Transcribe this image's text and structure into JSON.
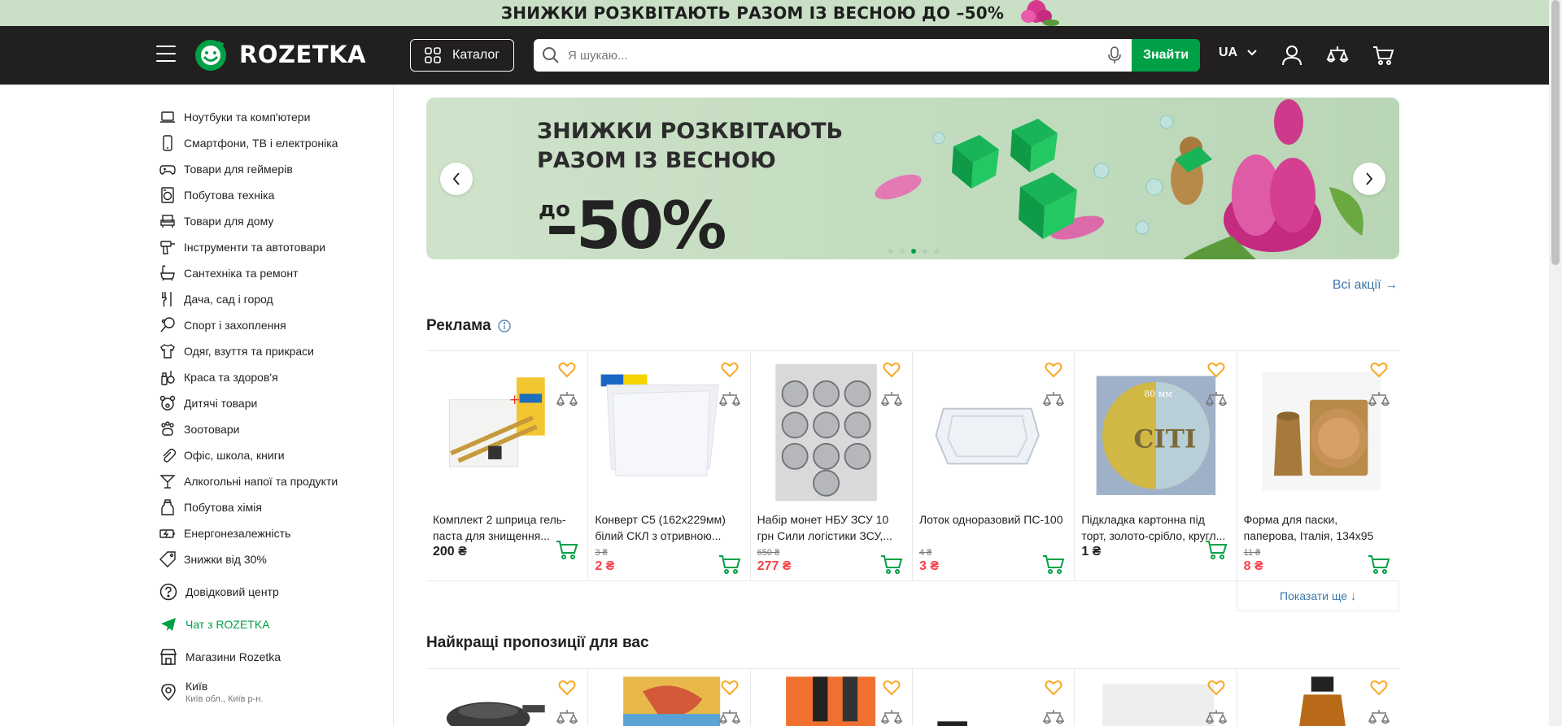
{
  "promo_strip": {
    "text": "ЗНИЖКИ РОЗКВІТАЮТЬ РАЗОМ ІЗ ВЕСНОЮ ДО –50%"
  },
  "header": {
    "logo_text": "ROZETKA",
    "catalog_label": "Каталог",
    "search_placeholder": "Я шукаю...",
    "search_button": "Знайти",
    "language": "UA"
  },
  "sidebar": {
    "categories": [
      {
        "label": "Ноутбуки та комп'ютери",
        "icon": "laptop-icon"
      },
      {
        "label": "Смартфони, ТВ і електроніка",
        "icon": "smartphone-icon"
      },
      {
        "label": "Товари для геймерів",
        "icon": "gamepad-icon"
      },
      {
        "label": "Побутова техніка",
        "icon": "washing-machine-icon"
      },
      {
        "label": "Товари для дому",
        "icon": "sofa-icon"
      },
      {
        "label": "Інструменти та автотовари",
        "icon": "drill-icon"
      },
      {
        "label": "Сантехніка та ремонт",
        "icon": "bathtub-icon"
      },
      {
        "label": "Дача, сад і город",
        "icon": "garden-fork-icon"
      },
      {
        "label": "Спорт і захоплення",
        "icon": "racket-icon"
      },
      {
        "label": "Одяг, взуття та прикраси",
        "icon": "tshirt-icon"
      },
      {
        "label": "Краса та здоров'я",
        "icon": "cosmetics-icon"
      },
      {
        "label": "Дитячі товари",
        "icon": "teddy-bear-icon"
      },
      {
        "label": "Зоотовари",
        "icon": "paw-icon"
      },
      {
        "label": "Офіс, школа, книги",
        "icon": "paperclip-icon"
      },
      {
        "label": "Алкогольні напої та продукти",
        "icon": "cocktail-icon"
      },
      {
        "label": "Побутова хімія",
        "icon": "detergent-icon"
      },
      {
        "label": "Енергонезалежність",
        "icon": "battery-icon"
      },
      {
        "label": "Знижки від 30%",
        "icon": "discount-tag-icon"
      }
    ],
    "help_center": "Довідковий центр",
    "chat": "Чат з ROZETKA",
    "stores": "Магазини Rozetka",
    "city": "Київ",
    "city_region": "Київ обл., Київ р-н."
  },
  "banner": {
    "title": "ЗНИЖКИ РОЗКВІТАЮТЬ РАЗОМ ІЗ ВЕСНОЮ",
    "prefix": "до",
    "discount": "–50%",
    "slide_count": 5,
    "active_slide": 3
  },
  "all_promos": "Всі акції →",
  "ads_section": {
    "title": "Реклама",
    "products": [
      {
        "title": "Комплект 2 шприца гель-паста для знищення...",
        "old_price": "",
        "price": "200 ₴",
        "sale": false
      },
      {
        "title": "Конверт С5 (162х229мм) білий СКЛ з отривною...",
        "old_price": "3 ₴",
        "price": "2 ₴",
        "sale": true
      },
      {
        "title": "Набір монет НБУ ЗСУ 10 грн Сили логістики ЗСУ,...",
        "old_price": "650 ₴",
        "price": "277 ₴",
        "sale": true
      },
      {
        "title": "Лоток одноразовий ПС-100",
        "old_price": "4 ₴",
        "price": "3 ₴",
        "sale": true
      },
      {
        "title": "Підкладка картонна під торт, золото-срібло, кругл...",
        "old_price": "",
        "price": "1 ₴",
        "sale": false
      },
      {
        "title": "Форма для паски, паперова, Італія, 134х95 м...",
        "old_price": "11 ₴",
        "price": "8 ₴",
        "sale": true
      }
    ],
    "image_labels": {
      "citi": "CITI",
      "size": "80 мм"
    },
    "show_more": "Показати ще ↓"
  },
  "best_offers_section": {
    "title": "Найкращі пропозиції для вас"
  },
  "colors": {
    "header_bg": "#221f1f",
    "green": "#00a046",
    "red": "#f84147",
    "link": "#3e77aa",
    "fav": "#f9a825"
  }
}
